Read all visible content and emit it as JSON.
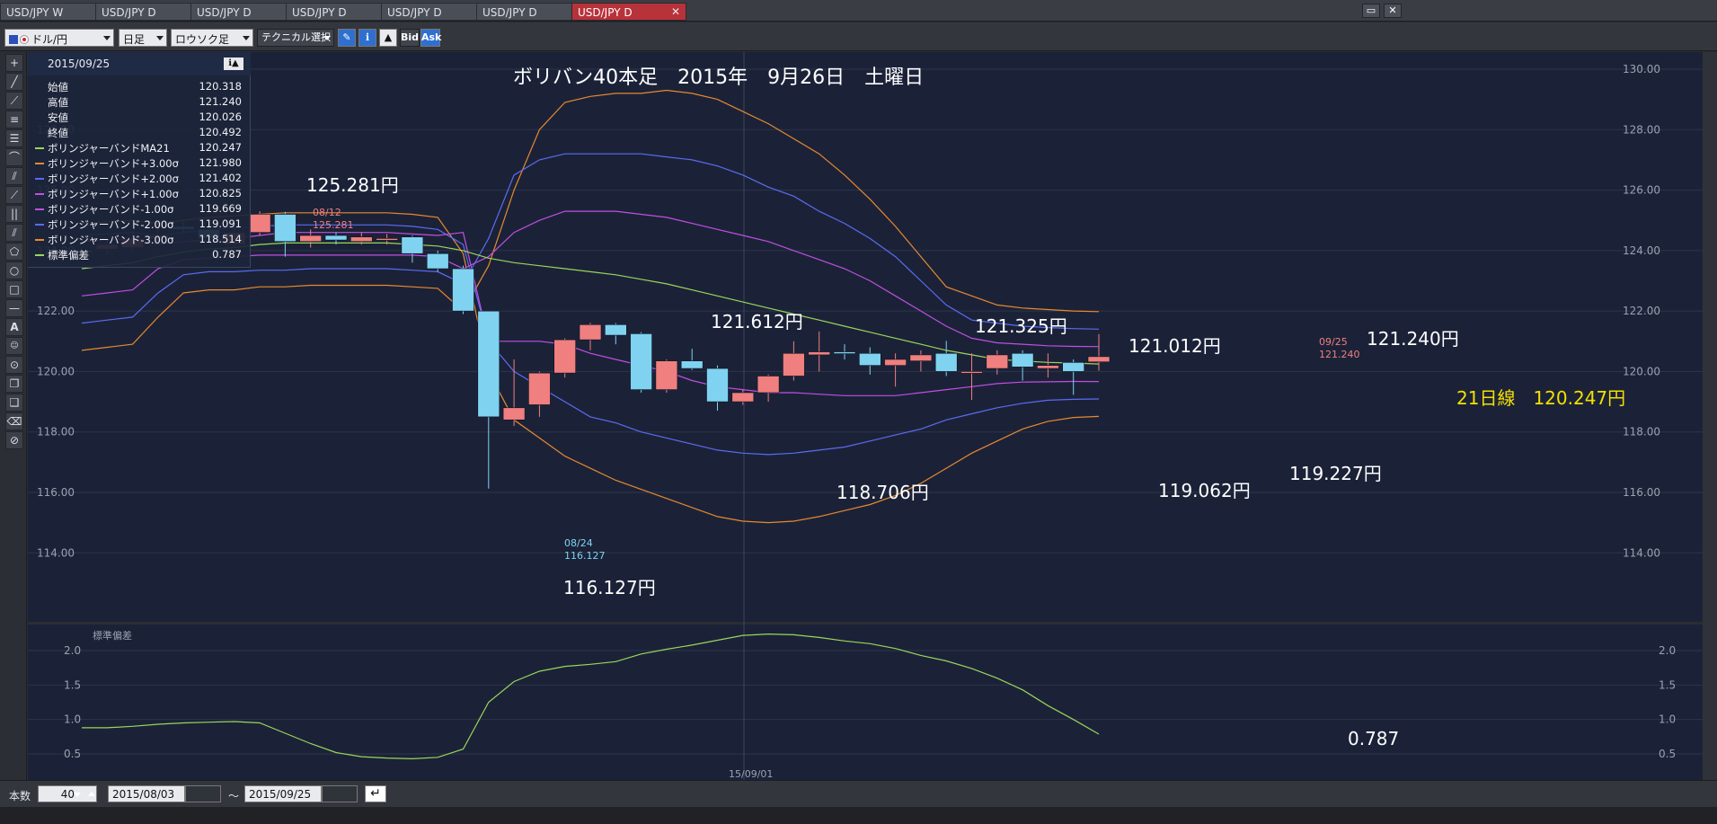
{
  "tabs": [
    {
      "label": "USD/JPY W",
      "active": false
    },
    {
      "label": "USD/JPY D",
      "active": false
    },
    {
      "label": "USD/JPY D",
      "active": false
    },
    {
      "label": "USD/JPY D",
      "active": false
    },
    {
      "label": "USD/JPY D",
      "active": false
    },
    {
      "label": "USD/JPY D",
      "active": false
    },
    {
      "label": "USD/JPY D",
      "active": true
    }
  ],
  "tab_close_glyph": "✕",
  "toolbar": {
    "pair": "ドル/円",
    "timeframe": "日足",
    "chart_type": "ロウソク足",
    "technical": "テクニカル選択",
    "bid": "Bid",
    "ask": "Ask"
  },
  "info_panel": {
    "date": "2015/09/25",
    "rows": [
      {
        "label": "始値",
        "value": "120.318",
        "color": ""
      },
      {
        "label": "高値",
        "value": "121.240",
        "color": ""
      },
      {
        "label": "安値",
        "value": "120.026",
        "color": ""
      },
      {
        "label": "終値",
        "value": "120.492",
        "color": ""
      },
      {
        "label": "ボリンジャーバンドMA21",
        "value": "120.247",
        "color": "#9ad65a"
      },
      {
        "label": "ボリンジャーバンド+3.00σ",
        "value": "121.980",
        "color": "#e8892e"
      },
      {
        "label": "ボリンジャーバンド+2.00σ",
        "value": "121.402",
        "color": "#5a6cf0"
      },
      {
        "label": "ボリンジャーバンド+1.00σ",
        "value": "120.825",
        "color": "#c04fe0"
      },
      {
        "label": "ボリンジャーバンド-1.00σ",
        "value": "119.669",
        "color": "#c04fe0"
      },
      {
        "label": "ボリンジャーバンド-2.00σ",
        "value": "119.091",
        "color": "#5a6cf0"
      },
      {
        "label": "ボリンジャーバンド-3.00σ",
        "value": "118.514",
        "color": "#e8892e"
      },
      {
        "label": "標準偏差",
        "value": "0.787",
        "color": "#9ad65a"
      }
    ]
  },
  "chart_data": {
    "type": "candlestick",
    "title": "ボリバン40本足　2015年　9月26日　土曜日",
    "y_ticks": [
      "130.00",
      "128.00",
      "126.00",
      "124.00",
      "122.00",
      "120.00",
      "118.00",
      "116.00",
      "114.00"
    ],
    "ylim": [
      113.2,
      131.2
    ],
    "x_tick_label": "15/09/01",
    "candles": [
      {
        "o": 124.0,
        "h": 124.1,
        "l": 123.9,
        "c": 123.95
      },
      {
        "o": 124.05,
        "h": 124.4,
        "l": 123.9,
        "c": 124.2
      },
      {
        "o": 124.1,
        "h": 124.6,
        "l": 124.0,
        "c": 124.4
      },
      {
        "o": 124.4,
        "h": 124.9,
        "l": 124.2,
        "c": 124.5
      },
      {
        "o": 124.8,
        "h": 124.95,
        "l": 124.6,
        "c": 124.7
      },
      {
        "o": 124.7,
        "h": 124.8,
        "l": 124.3,
        "c": 124.4
      },
      {
        "o": 124.2,
        "h": 124.8,
        "l": 124.1,
        "c": 124.6
      },
      {
        "o": 124.6,
        "h": 125.3,
        "l": 124.5,
        "c": 125.2
      },
      {
        "o": 125.2,
        "h": 125.281,
        "l": 123.8,
        "c": 124.3
      },
      {
        "o": 124.3,
        "h": 124.7,
        "l": 124.1,
        "c": 124.5
      },
      {
        "o": 124.5,
        "h": 124.6,
        "l": 124.2,
        "c": 124.35
      },
      {
        "o": 124.3,
        "h": 124.6,
        "l": 124.2,
        "c": 124.45
      },
      {
        "o": 124.4,
        "h": 124.55,
        "l": 124.2,
        "c": 124.4
      },
      {
        "o": 124.45,
        "h": 124.5,
        "l": 123.6,
        "c": 123.9
      },
      {
        "o": 123.9,
        "h": 124.0,
        "l": 123.3,
        "c": 123.4
      },
      {
        "o": 123.4,
        "h": 123.5,
        "l": 121.9,
        "c": 122.0
      },
      {
        "o": 122.0,
        "h": 122.0,
        "l": 116.127,
        "c": 118.5
      },
      {
        "o": 118.4,
        "h": 120.4,
        "l": 118.2,
        "c": 118.8
      },
      {
        "o": 118.9,
        "h": 120.0,
        "l": 118.5,
        "c": 119.95
      },
      {
        "o": 119.95,
        "h": 121.1,
        "l": 119.8,
        "c": 121.05
      },
      {
        "o": 121.05,
        "h": 121.612,
        "l": 120.7,
        "c": 121.55
      },
      {
        "o": 121.55,
        "h": 121.6,
        "l": 120.9,
        "c": 121.2
      },
      {
        "o": 121.25,
        "h": 121.3,
        "l": 119.3,
        "c": 119.4
      },
      {
        "o": 119.4,
        "h": 120.4,
        "l": 119.3,
        "c": 120.35
      },
      {
        "o": 120.35,
        "h": 120.75,
        "l": 120.05,
        "c": 120.1
      },
      {
        "o": 120.1,
        "h": 120.2,
        "l": 118.706,
        "c": 119.0
      },
      {
        "o": 119.0,
        "h": 119.4,
        "l": 118.9,
        "c": 119.3
      },
      {
        "o": 119.3,
        "h": 119.9,
        "l": 119.0,
        "c": 119.85
      },
      {
        "o": 119.85,
        "h": 121.0,
        "l": 119.7,
        "c": 120.6
      },
      {
        "o": 120.55,
        "h": 121.325,
        "l": 120.0,
        "c": 120.65
      },
      {
        "o": 120.65,
        "h": 120.9,
        "l": 120.4,
        "c": 120.6
      },
      {
        "o": 120.6,
        "h": 120.8,
        "l": 119.9,
        "c": 120.2
      },
      {
        "o": 120.2,
        "h": 120.6,
        "l": 119.5,
        "c": 120.4
      },
      {
        "o": 120.35,
        "h": 120.7,
        "l": 120.0,
        "c": 120.55
      },
      {
        "o": 120.6,
        "h": 121.012,
        "l": 119.85,
        "c": 120.0
      },
      {
        "o": 120.0,
        "h": 120.6,
        "l": 119.062,
        "c": 120.0
      },
      {
        "o": 120.1,
        "h": 120.7,
        "l": 119.9,
        "c": 120.55
      },
      {
        "o": 120.6,
        "h": 120.7,
        "l": 119.7,
        "c": 120.15
      },
      {
        "o": 120.1,
        "h": 120.6,
        "l": 119.8,
        "c": 120.2
      },
      {
        "o": 120.3,
        "h": 120.4,
        "l": 119.227,
        "c": 120.0
      },
      {
        "o": 120.318,
        "h": 121.24,
        "l": 120.026,
        "c": 120.492
      }
    ],
    "bands": {
      "ma21": [
        123.4,
        123.5,
        123.6,
        123.8,
        123.95,
        124.05,
        124.1,
        124.2,
        124.25,
        124.25,
        124.25,
        124.25,
        124.25,
        124.2,
        124.15,
        124.0,
        123.75,
        123.6,
        123.5,
        123.4,
        123.3,
        123.2,
        123.05,
        122.9,
        122.7,
        122.5,
        122.3,
        122.1,
        121.9,
        121.7,
        121.5,
        121.3,
        121.1,
        120.9,
        120.7,
        120.55,
        120.4,
        120.35,
        120.3,
        120.28,
        120.247
      ],
      "p3": [
        120.7,
        120.8,
        120.9,
        121.8,
        122.6,
        122.7,
        122.7,
        122.8,
        122.8,
        122.85,
        122.85,
        122.85,
        122.85,
        122.8,
        122.75,
        122.0,
        123.5,
        126.0,
        128.0,
        128.9,
        129.1,
        129.2,
        129.2,
        129.3,
        129.2,
        129.0,
        128.6,
        128.2,
        127.7,
        127.2,
        126.5,
        125.7,
        124.8,
        123.8,
        122.8,
        122.5,
        122.2,
        122.1,
        122.05,
        122.0,
        121.98
      ],
      "p2": [
        121.6,
        121.7,
        121.8,
        122.6,
        123.2,
        123.3,
        123.3,
        123.35,
        123.35,
        123.4,
        123.4,
        123.4,
        123.4,
        123.35,
        123.3,
        122.9,
        124.4,
        126.5,
        127.0,
        127.2,
        127.2,
        127.2,
        127.2,
        127.1,
        127.0,
        126.8,
        126.5,
        126.1,
        125.8,
        125.3,
        124.9,
        124.4,
        123.8,
        123.0,
        122.2,
        121.7,
        121.6,
        121.5,
        121.45,
        121.42,
        121.402
      ],
      "p1": [
        122.5,
        122.6,
        122.7,
        123.4,
        123.7,
        123.75,
        123.8,
        123.85,
        123.85,
        123.85,
        123.85,
        123.85,
        123.85,
        123.85,
        123.8,
        123.4,
        123.8,
        124.6,
        125.0,
        125.3,
        125.3,
        125.3,
        125.2,
        125.1,
        124.9,
        124.7,
        124.5,
        124.3,
        124.0,
        123.7,
        123.4,
        123.0,
        122.5,
        122.0,
        121.5,
        121.1,
        120.95,
        120.9,
        120.85,
        120.83,
        120.825
      ],
      "m1": [
        124.3,
        124.35,
        124.4,
        124.2,
        124.3,
        124.35,
        124.4,
        124.5,
        124.6,
        124.6,
        124.6,
        124.6,
        124.6,
        124.55,
        124.5,
        124.6,
        121.0,
        121.0,
        121.0,
        120.9,
        120.6,
        120.4,
        120.2,
        120.0,
        119.7,
        119.5,
        119.4,
        119.3,
        119.3,
        119.25,
        119.2,
        119.2,
        119.2,
        119.3,
        119.4,
        119.5,
        119.6,
        119.65,
        119.66,
        119.67,
        119.669
      ],
      "m2": [
        124.5,
        124.55,
        124.6,
        124.5,
        124.6,
        124.7,
        124.75,
        124.8,
        124.85,
        124.85,
        124.85,
        124.85,
        124.85,
        124.8,
        124.7,
        124.2,
        121.0,
        120.0,
        119.5,
        119.0,
        118.5,
        118.3,
        118.0,
        117.8,
        117.6,
        117.4,
        117.3,
        117.25,
        117.3,
        117.4,
        117.5,
        117.7,
        117.9,
        118.1,
        118.4,
        118.6,
        118.8,
        118.95,
        119.05,
        119.08,
        119.091
      ],
      "m3": [
        124.9,
        124.95,
        125.0,
        124.9,
        125.0,
        125.1,
        125.15,
        125.2,
        125.25,
        125.25,
        125.25,
        125.25,
        125.25,
        125.2,
        125.1,
        123.9,
        120.0,
        118.4,
        117.8,
        117.2,
        116.8,
        116.4,
        116.1,
        115.8,
        115.5,
        115.2,
        115.05,
        115.0,
        115.05,
        115.2,
        115.4,
        115.6,
        115.9,
        116.3,
        116.8,
        117.3,
        117.7,
        118.1,
        118.35,
        118.48,
        118.514
      ]
    },
    "markers": {
      "high": {
        "date": "08/12",
        "value": "125.281"
      },
      "low": {
        "date": "08/24",
        "value": "116.127"
      },
      "last": {
        "date": "09/25",
        "value": "121.240"
      }
    },
    "annotations": [
      "125.281円",
      "121.612円",
      "121.325円",
      "121.012円",
      "121.240円",
      "116.127円",
      "118.706円",
      "119.062円",
      "119.227円",
      "21日線　120.247円"
    ],
    "sub_chart": {
      "label": "標準偏差",
      "y_ticks": [
        "2.0",
        "1.5",
        "1.0",
        "0.5"
      ],
      "ylim": [
        0.35,
        2.45
      ],
      "values": [
        0.88,
        0.88,
        0.9,
        0.93,
        0.95,
        0.96,
        0.97,
        0.95,
        0.8,
        0.65,
        0.52,
        0.46,
        0.44,
        0.43,
        0.45,
        0.57,
        1.25,
        1.55,
        1.7,
        1.77,
        1.8,
        1.84,
        1.95,
        2.02,
        2.08,
        2.15,
        2.22,
        2.24,
        2.23,
        2.19,
        2.14,
        2.1,
        2.03,
        1.93,
        1.85,
        1.74,
        1.6,
        1.43,
        1.2,
        1.0,
        0.787
      ],
      "annotation": "0.787"
    },
    "colors": {
      "bull": "#f07f7f",
      "bear": "#7fd3f0",
      "ma": "#9ad65a",
      "sigma1": "#c04fe0",
      "sigma2": "#5a6cf0",
      "sigma3": "#e8892e",
      "annotation_yellow": "#f4e000",
      "marker_red": "#f07f7f",
      "marker_blue": "#7fd3f0"
    }
  },
  "bottom": {
    "count_label": "本数",
    "count_value": "40",
    "start_date": "2015/08/03",
    "tilde": "〜",
    "end_date": "2015/09/25"
  }
}
